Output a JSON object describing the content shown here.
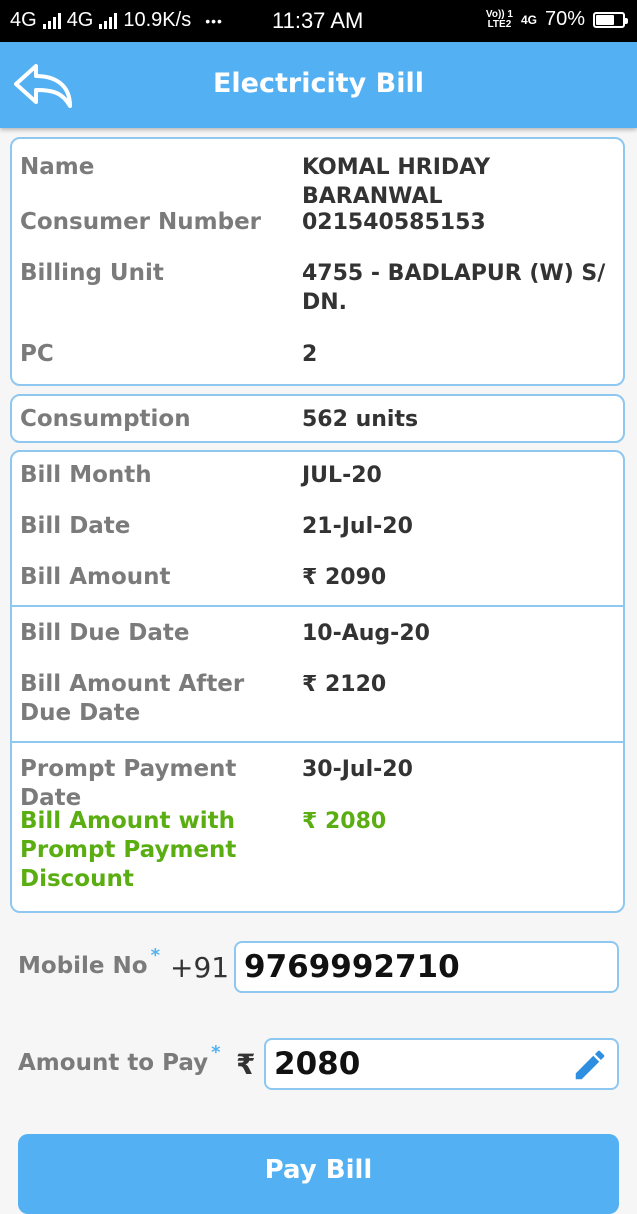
{
  "status_bar": {
    "network1": "4G",
    "network2": "4G",
    "speed": "10.9K/s",
    "dots": "•••",
    "time": "11:37 AM",
    "volte_top": "Vo)) 1",
    "volte_bottom": "LTE2",
    "net_small": "4G",
    "battery_text": "70%",
    "battery_level": 0.7
  },
  "app_bar": {
    "title": "Electricity Bill",
    "back_icon": "back-arrow-icon",
    "color": "#53b1f3"
  },
  "consumer": {
    "name_label": "Name",
    "name_value": "KOMAL HRIDAY BARANWAL",
    "number_label": "Consumer Number",
    "number_value": "021540585153",
    "unit_label": "Billing Unit",
    "unit_value": "4755 - BADLAPUR (W) S/ DN.",
    "pc_label": "PC",
    "pc_value": "2"
  },
  "consumption": {
    "label": "Consumption",
    "value": "562 units"
  },
  "bill": {
    "month_label": "Bill Month",
    "month_value": "JUL-20",
    "date_label": "Bill Date",
    "date_value": "21-Jul-20",
    "amount_label": "Bill Amount",
    "amount_value": "₹ 2090",
    "due_label": "Bill Due Date",
    "due_value": "10-Aug-20",
    "after_due_label": "Bill Amount After Due Date",
    "after_due_value": "₹ 2120",
    "prompt_label": "Prompt Payment Date",
    "prompt_value": "30-Jul-20",
    "discount_label": "Bill Amount with Prompt Payment Discount",
    "discount_value": "₹ 2080",
    "discount_color": "#5aae12"
  },
  "form": {
    "mobile_label": "Mobile No",
    "required_mark": "*",
    "country_code": "+91",
    "mobile_value": "9769992710",
    "amount_label": "Amount to Pay",
    "currency": "₹",
    "amount_value": "2080",
    "edit_icon": "pencil-icon"
  },
  "pay_button": {
    "label": "Pay Bill"
  }
}
